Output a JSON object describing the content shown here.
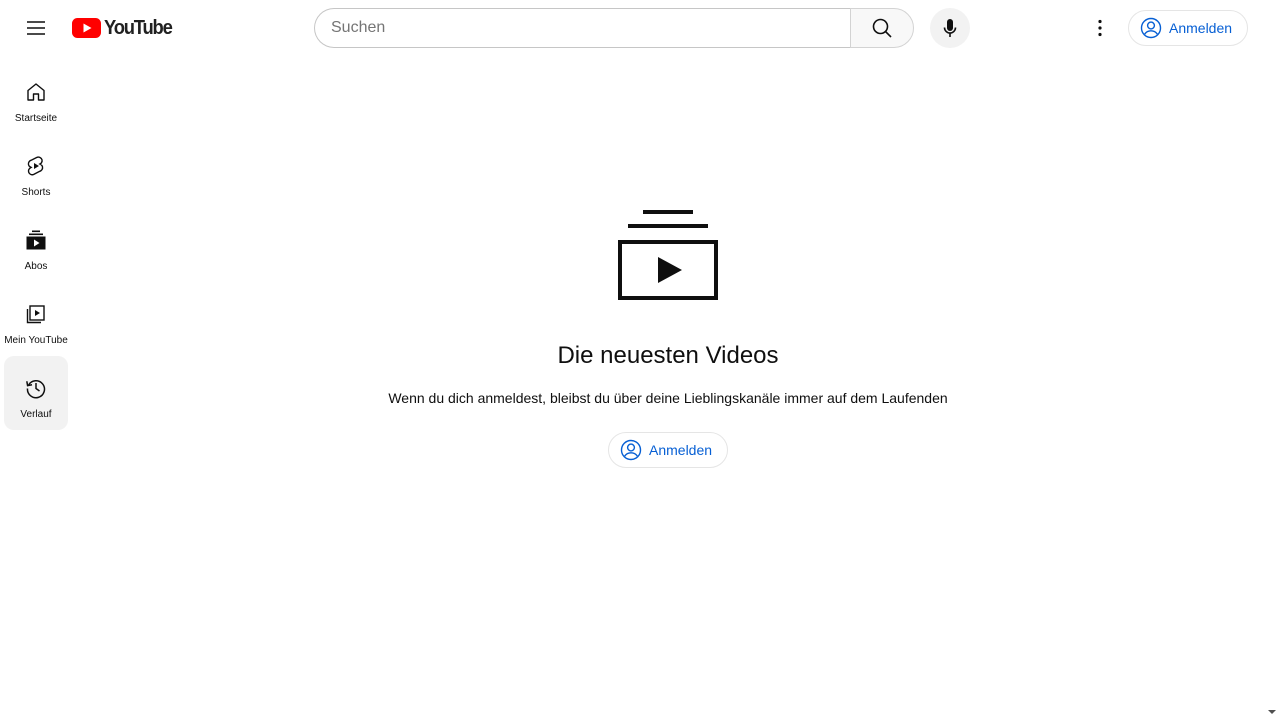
{
  "masthead": {
    "logo_text": "YouTube",
    "search_placeholder": "Suchen",
    "search_value": "",
    "signin_label": "Anmelden",
    "icons": {
      "menu": "hamburger-icon",
      "search": "search-icon",
      "mic": "microphone-icon",
      "more": "more-vertical-icon",
      "account": "account-circle-icon"
    },
    "brand_color": "#ff0000",
    "link_color": "#065fd4"
  },
  "guide": {
    "items": [
      {
        "label": "Startseite",
        "icon": "home-icon",
        "active": false
      },
      {
        "label": "Shorts",
        "icon": "shorts-icon",
        "active": false
      },
      {
        "label": "Abos",
        "icon": "subscriptions-icon",
        "active": false
      },
      {
        "label": "Mein YouTube",
        "icon": "my-youtube-icon",
        "active": false
      },
      {
        "label": "Verlauf",
        "icon": "history-icon",
        "active": true
      }
    ]
  },
  "empty_state": {
    "icon": "subscriptions-icon",
    "title": "Die neuesten Videos",
    "subtitle": "Wenn du dich anmeldest, bleibst du über deine Lieblingskanäle immer auf dem Laufenden",
    "signin_label": "Anmelden"
  }
}
